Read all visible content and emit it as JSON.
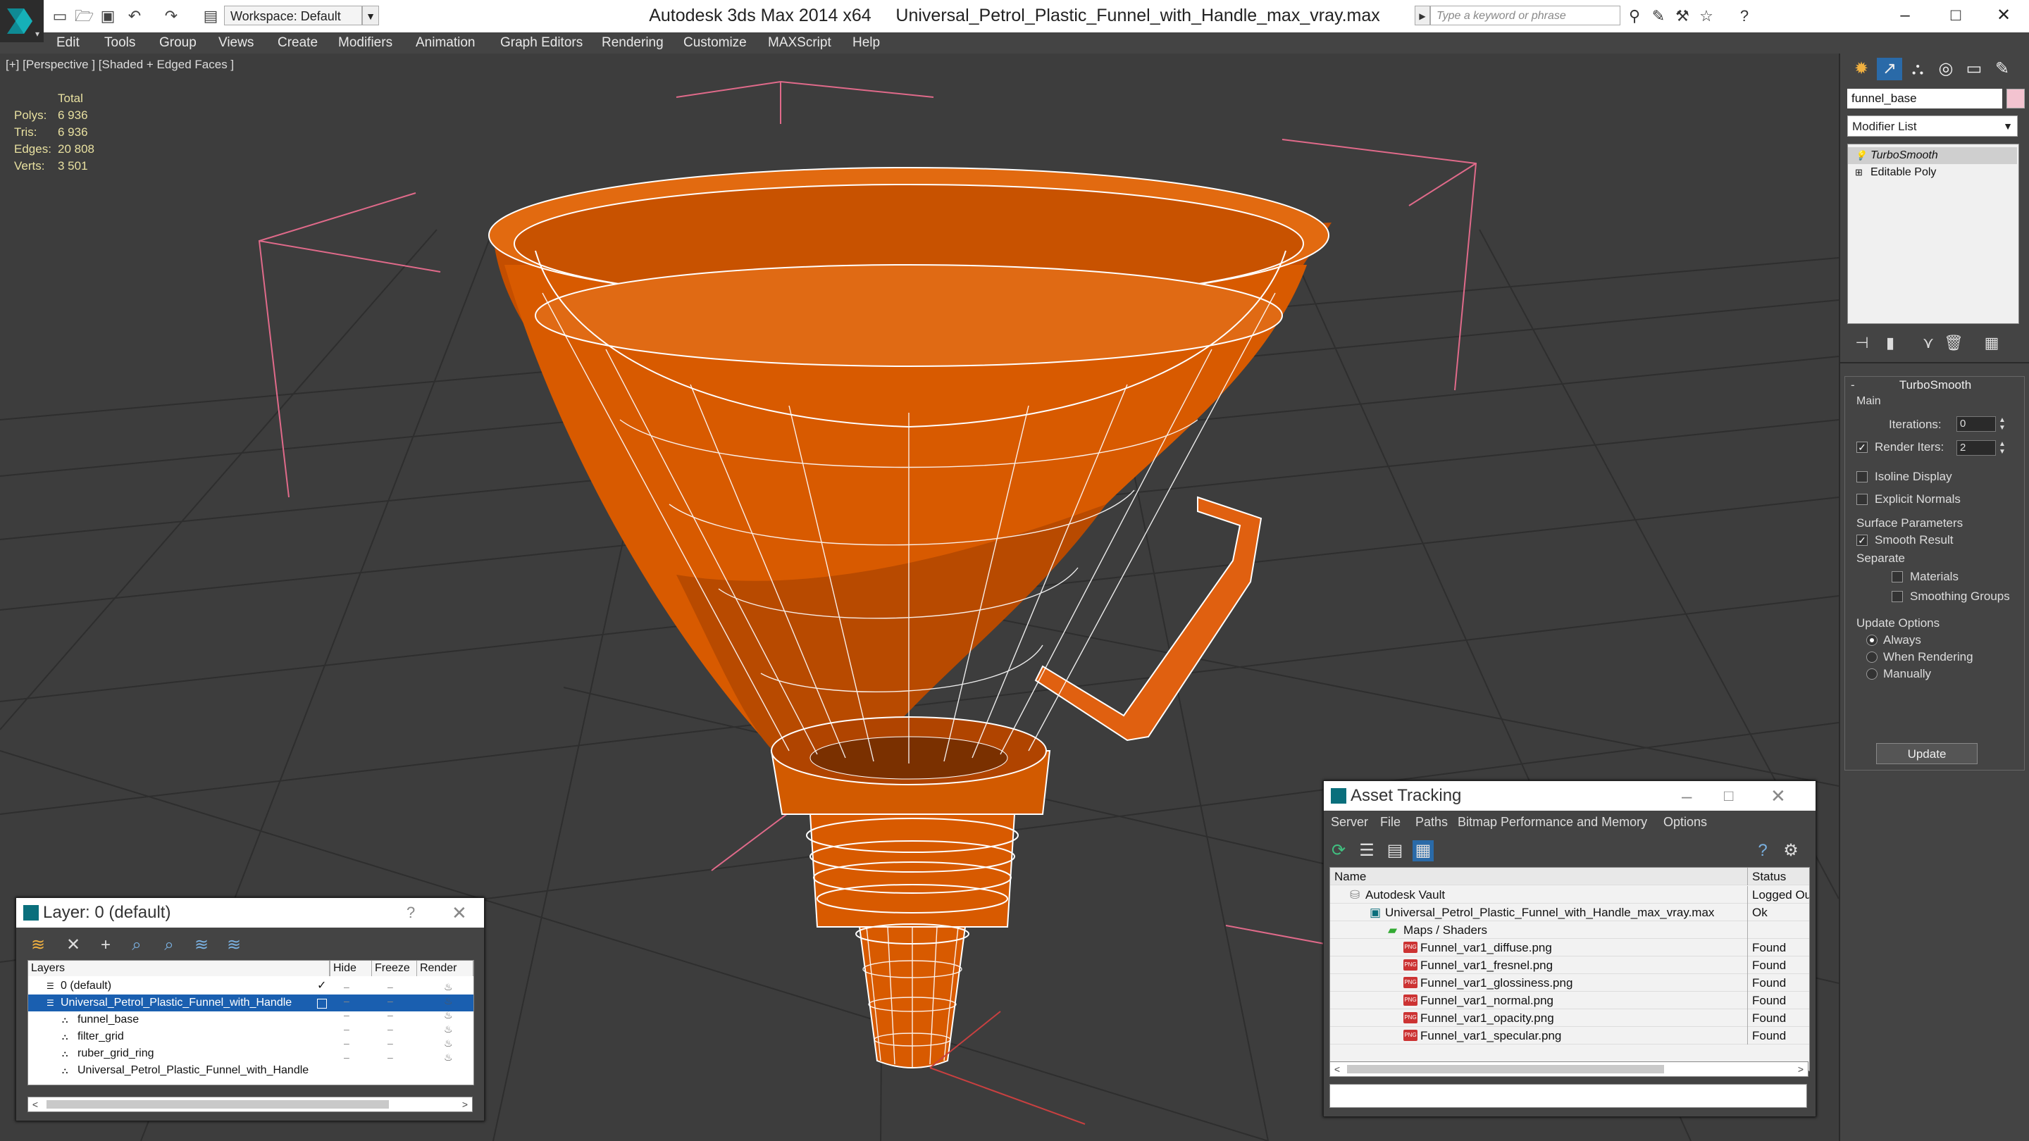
{
  "app": {
    "title": "Autodesk 3ds Max  2014 x64",
    "file": "Universal_Petrol_Plastic_Funnel_with_Handle_max_vray.max",
    "workspace": "Workspace: Default",
    "search_placeholder": "Type a keyword or phrase"
  },
  "menu": [
    "Edit",
    "Tools",
    "Group",
    "Views",
    "Create",
    "Modifiers",
    "Animation",
    "Graph Editors",
    "Rendering",
    "Customize",
    "MAXScript",
    "Help"
  ],
  "viewport": {
    "label": "[+] [Perspective ] [Shaded + Edged Faces ]",
    "stats": {
      "header": "Total",
      "polys_label": "Polys:",
      "polys": "6 936",
      "tris_label": "Tris:",
      "tris": "6 936",
      "edges_label": "Edges:",
      "edges": "20 808",
      "verts_label": "Verts:",
      "verts": "3 501"
    }
  },
  "command_panel": {
    "object_name": "funnel_base",
    "modifier_list": "Modifier List",
    "stack": [
      "TurboSmooth",
      "Editable Poly"
    ],
    "turbosmooth": {
      "title": "TurboSmooth",
      "main": "Main",
      "iterations_label": "Iterations:",
      "iterations": "0",
      "render_iters_label": "Render Iters:",
      "render_iters": "2",
      "isoline": "Isoline Display",
      "explicit_normals": "Explicit Normals",
      "surface_params": "Surface Parameters",
      "smooth_result": "Smooth Result",
      "separate": "Separate",
      "materials": "Materials",
      "smoothing_groups": "Smoothing Groups",
      "update_options": "Update Options",
      "always": "Always",
      "when_rendering": "When Rendering",
      "manually": "Manually",
      "update": "Update"
    }
  },
  "layer_panel": {
    "title": "Layer: 0 (default)",
    "help": "?",
    "columns": [
      "Layers",
      "Hide",
      "Freeze",
      "Render"
    ],
    "rows": [
      {
        "name": "0 (default)"
      },
      {
        "name": "Universal_Petrol_Plastic_Funnel_with_Handle"
      },
      {
        "name": "funnel_base"
      },
      {
        "name": "filter_grid"
      },
      {
        "name": "ruber_grid_ring"
      },
      {
        "name": "Universal_Petrol_Plastic_Funnel_with_Handle"
      }
    ]
  },
  "asset_tracking": {
    "title": "Asset Tracking",
    "menu": [
      "Server",
      "File",
      "Paths",
      "Bitmap Performance and Memory",
      "Options"
    ],
    "columns": [
      "Name",
      "Status"
    ],
    "rows": [
      {
        "name": "Autodesk Vault",
        "status": "Logged Ou"
      },
      {
        "name": "Universal_Petrol_Plastic_Funnel_with_Handle_max_vray.max",
        "status": "Ok"
      },
      {
        "name": "Maps / Shaders",
        "status": ""
      },
      {
        "name": "Funnel_var1_diffuse.png",
        "status": "Found"
      },
      {
        "name": "Funnel_var1_fresnel.png",
        "status": "Found"
      },
      {
        "name": "Funnel_var1_glossiness.png",
        "status": "Found"
      },
      {
        "name": "Funnel_var1_normal.png",
        "status": "Found"
      },
      {
        "name": "Funnel_var1_opacity.png",
        "status": "Found"
      },
      {
        "name": "Funnel_var1_specular.png",
        "status": "Found"
      }
    ]
  },
  "colors": {
    "funnel": "#d85a00",
    "wire": "#ffffff",
    "selection": "#1a5fb0",
    "gizmo": "#e06a8a"
  }
}
